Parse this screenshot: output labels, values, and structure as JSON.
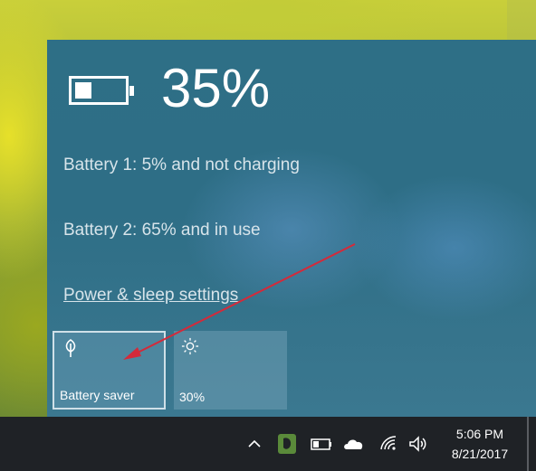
{
  "battery_flyout": {
    "percent": "35%",
    "battery_level": 0.35,
    "battery1_status": "Battery 1: 5% and not charging",
    "battery2_status": "Battery 2: 65% and in use",
    "power_link": "Power & sleep settings"
  },
  "quick_actions": [
    {
      "label": "Battery saver",
      "icon": "leaf-icon",
      "active": true
    },
    {
      "label": "30%",
      "icon": "brightness-icon",
      "active": false
    }
  ],
  "taskbar": {
    "tray_icons": [
      "chevron-up-icon",
      "evernote-icon",
      "battery-icon",
      "onedrive-cloud-icon",
      "wifi-icon",
      "volume-icon"
    ],
    "time": "5:06 PM",
    "date": "8/21/2017"
  },
  "colors": {
    "flyout_bg": "#2e6f86",
    "taskbar_bg": "#1f2226",
    "annotation_arrow": "#d42a3a"
  }
}
